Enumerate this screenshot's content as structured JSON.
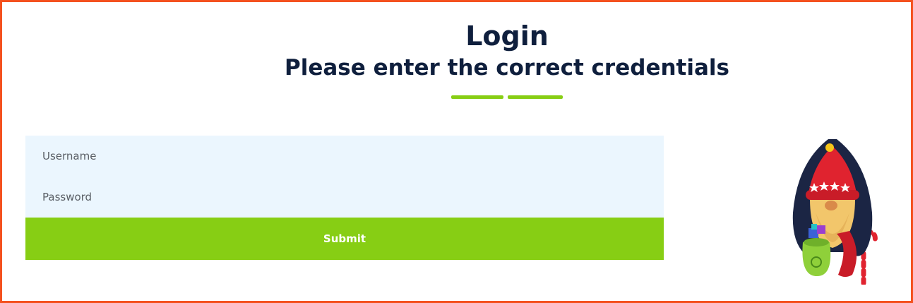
{
  "header": {
    "title": "Login",
    "subtitle": "Please enter the correct credentials"
  },
  "form": {
    "username_placeholder": "Username",
    "password_placeholder": "Password",
    "submit_label": "Submit"
  },
  "colors": {
    "accent": "#87ce14",
    "border": "#f4511e",
    "heading": "#0f1f3d",
    "field_background": "#ebf6fe"
  },
  "icons": {
    "mascot": "gnome-mascot-icon"
  }
}
